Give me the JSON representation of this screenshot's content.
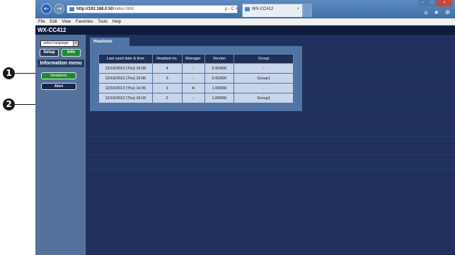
{
  "callouts": [
    "1",
    "2"
  ],
  "browser": {
    "url_host": "http://192.168.0.50",
    "url_path": "/index.html",
    "addr_actions": "ρ - C ×",
    "tab_title": "WX-CC412",
    "tab_close": "×",
    "win_min": "–",
    "win_max": "□",
    "win_close": "×",
    "util_icons": "⌂ ★ ⚙",
    "back_glyph": "←",
    "fwd_glyph": "→"
  },
  "menubar": [
    "File",
    "Edit",
    "View",
    "Favorites",
    "Tools",
    "Help"
  ],
  "app": {
    "title": "WX-CC412"
  },
  "sidebar": {
    "language_placeholder": "-select language-",
    "language_chevron": "▾",
    "setup_label": "Setup",
    "info_label": "Info",
    "menu_title": "Information menu",
    "headsets_label": "Headsets",
    "alert_label": "Alert"
  },
  "panel": {
    "tab_label": "Headsets",
    "columns": [
      "Last used date & time",
      "Headset no.",
      "Manager",
      "Version",
      "Group"
    ],
    "rows": [
      [
        "12/19/2013 (Thu)  16:09",
        "4",
        "-",
        "0.91R00",
        "-"
      ],
      [
        "12/19/2013 (Thu)  16:06",
        "3",
        "-",
        "0.91R00",
        "Group1"
      ],
      [
        "12/19/2013 (Thu)  16:05",
        "1",
        "A",
        "1.00R00",
        "-"
      ],
      [
        "12/19/2013 (Thu)  16:03",
        "2",
        "-",
        "1.00R00",
        "Group1"
      ]
    ]
  }
}
